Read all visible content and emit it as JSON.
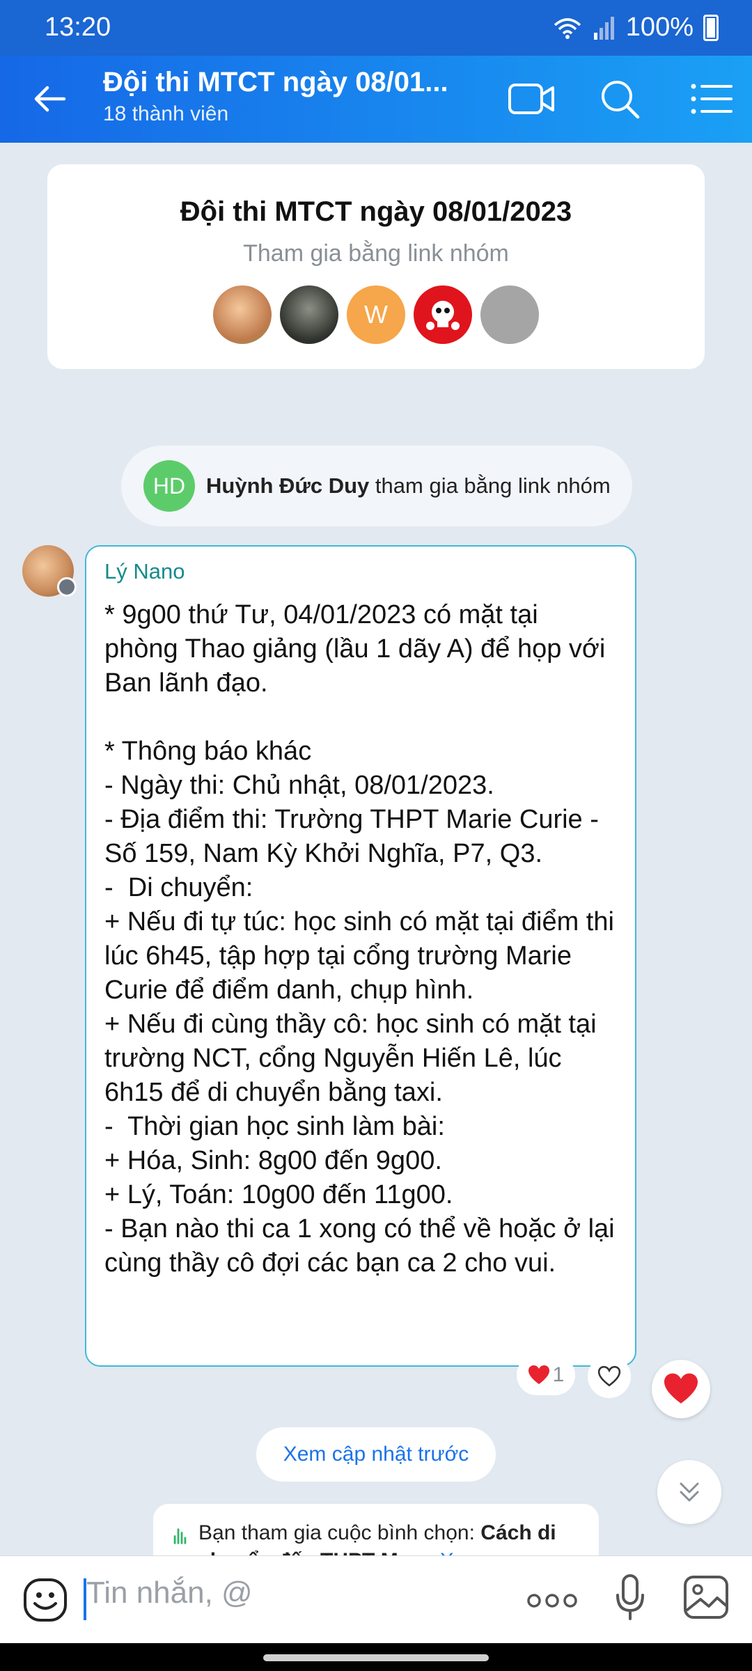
{
  "status_bar": {
    "time": "13:20",
    "battery": "100%"
  },
  "header": {
    "title": "Đội thi MTCT ngày 08/01...",
    "subtitle": "18 thành viên"
  },
  "group_card": {
    "title": "Đội thi MTCT ngày 08/01/2023",
    "subtitle": "Tham gia bằng link nhóm",
    "avatars": [
      {
        "initial": "",
        "color": "#d9a074"
      },
      {
        "initial": "",
        "color": "#3a3d36"
      },
      {
        "initial": "W",
        "color": "#f6a64b"
      },
      {
        "initial": "",
        "color": "#e0141c"
      },
      {
        "initial": "",
        "color": "#a5a5a5"
      }
    ]
  },
  "join_notice": {
    "initials": "HD",
    "name": "Huỳnh Đức Duy",
    "action": " tham gia bằng link nhóm"
  },
  "message": {
    "sender": "Lý Nano",
    "body": "* 9g00 thứ Tư, 04/01/2023 có mặt tại phòng Thao giảng (lầu 1 dãy A) để họp với Ban lãnh đạo.\n\n* Thông báo khác\n- Ngày thi: Chủ nhật, 08/01/2023.\n- Địa điểm thi: Trường THPT Marie Curie - Số 159, Nam Kỳ Khởi Nghĩa, P7, Q3.\n-  Di chuyển:\n+ Nếu đi tự túc: học sinh có mặt tại điểm thi lúc 6h45, tập hợp tại cổng trường Marie Curie để điểm danh, chụp hình.\n+ Nếu đi cùng thầy cô: học sinh có mặt tại trường NCT, cổng Nguyễn Hiến Lê, lúc 6h15 để di chuyển bằng taxi.\n-  Thời gian học sinh làm bài:\n+ Hóa, Sinh: 8g00 đến 9g00.\n+ Lý, Toán: 10g00 đến 11g00.\n- Bạn nào thi ca 1 xong có thể về hoặc ở lại cùng thầy cô đợi các bạn ca 2 cho vui.",
    "reaction_count": "1"
  },
  "prev_updates_label": "Xem cập nhật trước",
  "poll": {
    "prefix": "Bạn tham gia cuộc bình chọn: ",
    "title": "Cách di chuyển đến THPT Mar...",
    "more": "Xem"
  },
  "input": {
    "placeholder": "Tin nhắn, @"
  },
  "colors": {
    "header_start": "#1668e6",
    "header_end": "#1aa0f5",
    "accent": "#1a73e8",
    "heart": "#e8232f",
    "bubble_border": "#41b8d8"
  }
}
